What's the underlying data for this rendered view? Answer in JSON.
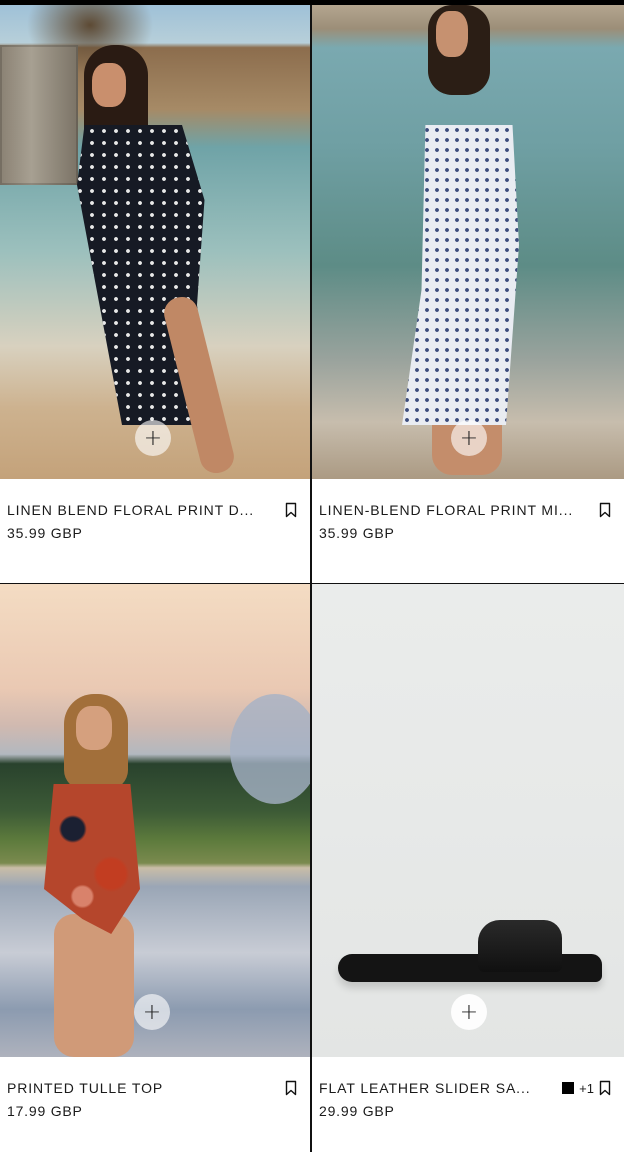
{
  "products": [
    {
      "name": "LINEN BLEND FLORAL PRINT D...",
      "price": "35.99 GBP",
      "quick_add": "+"
    },
    {
      "name": "LINEN-BLEND FLORAL PRINT MI...",
      "price": "35.99 GBP",
      "quick_add": "+"
    },
    {
      "name": "PRINTED TULLE TOP",
      "price": "17.99 GBP",
      "quick_add": "+"
    },
    {
      "name": "FLAT LEATHER SLIDER SA...",
      "price": "29.99 GBP",
      "quick_add": "+",
      "more_colors": "+1",
      "swatch_color": "#000000"
    }
  ],
  "icons": {
    "bookmark": "bookmark-icon",
    "quick_add": "plus-icon"
  }
}
